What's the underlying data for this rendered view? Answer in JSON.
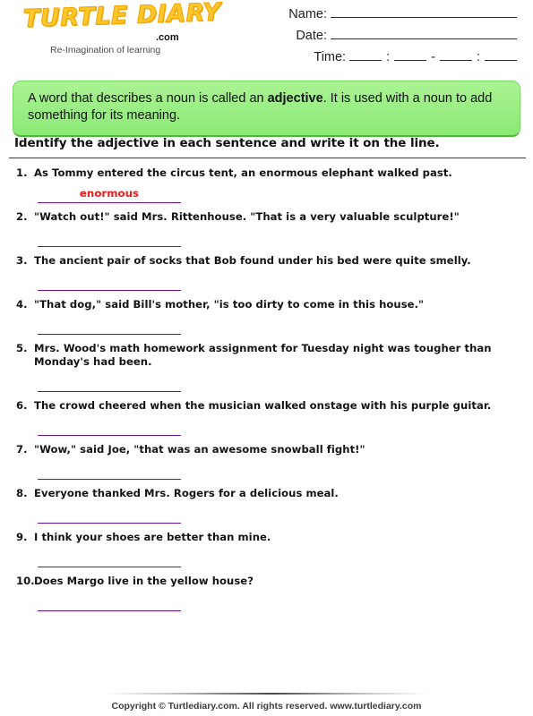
{
  "logo": {
    "word": "TURTLE DIARY",
    "dotcom": ".com",
    "tagline": "Re-Imagination of learning",
    "brand_color": "#FDC82F"
  },
  "header_fields": {
    "name_label": "Name:",
    "date_label": "Date:",
    "time_label": "Time:",
    "time_sep_colon": ":",
    "time_sep_dash": "-"
  },
  "note": {
    "part1": "A word that describes a noun is called an ",
    "bold": "adjective",
    "part2": ". It is used with a noun to add something for its meaning.",
    "background_color": "#9aee84"
  },
  "instruction": "Identify the adjective in each sentence and write it on the line.",
  "questions": [
    {
      "number": "1.",
      "text": "As Tommy entered the circus tent, an enormous elephant walked past.",
      "answer": "enormous"
    },
    {
      "number": "2.",
      "text": "\"Watch out!\" said Mrs. Rittenhouse. \"That is a very valuable sculpture!\"",
      "answer": ""
    },
    {
      "number": "3.",
      "text": "The ancient pair of socks that Bob found under his bed were quite smelly.",
      "answer": ""
    },
    {
      "number": "4.",
      "text": "\"That dog,\" said Bill's mother, \"is too dirty to come in this house.\"",
      "answer": ""
    },
    {
      "number": "5.",
      "text": "Mrs. Wood's math homework assignment for Tuesday night was tougher than Monday's had been.",
      "answer": ""
    },
    {
      "number": "6.",
      "text": "The crowd cheered when the musician walked onstage with his purple guitar.",
      "answer": ""
    },
    {
      "number": "7.",
      "text": "\"Wow,\" said Joe, \"that was an awesome snowball fight!\"",
      "answer": ""
    },
    {
      "number": "8.",
      "text": "Everyone thanked Mrs. Rogers for a delicious meal.",
      "answer": ""
    },
    {
      "number": "9.",
      "text": "I think your shoes are better than mine.",
      "answer": ""
    },
    {
      "number": "10.",
      "text": "Does Margo live in the yellow house?",
      "answer": ""
    }
  ],
  "answer_colors": {
    "text": "#ee1c1c",
    "line": "#6a11a8"
  },
  "footer": "Copyright © Turtlediary.com. All rights reserved. www.turtlediary.com"
}
